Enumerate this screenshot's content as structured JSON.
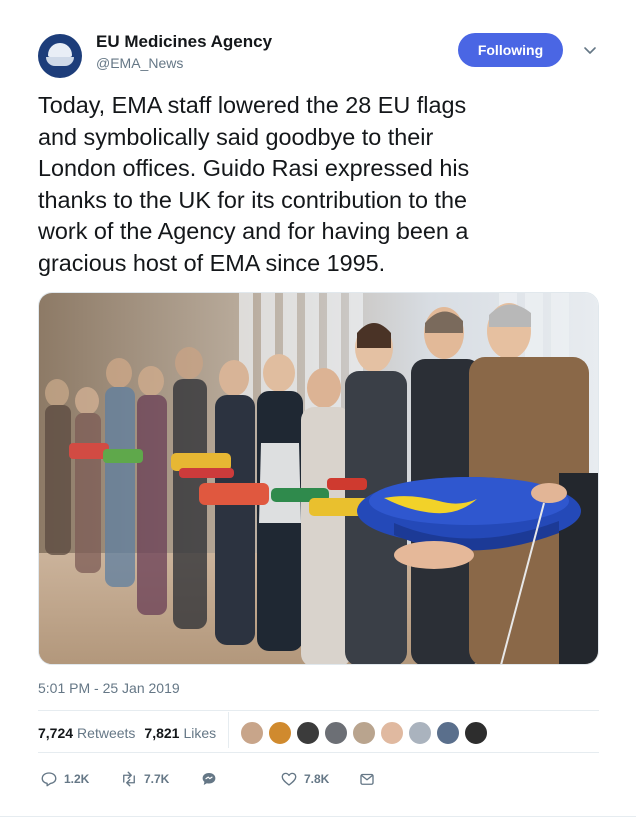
{
  "author": {
    "name": "EU Medicines Agency",
    "handle": "@EMA_News"
  },
  "follow_button": {
    "label": "Following"
  },
  "tweet": {
    "text_lines": [
      "Today, EMA staff lowered the 28 EU flags",
      "and symbolically said goodbye to their",
      "London offices. Guido Rasi expressed his",
      "thanks to the UK for its contribution to the",
      "work of the Agency and for having been a",
      "gracious host of EMA since 1995."
    ],
    "timestamp": "5:01 PM - 25 Jan 2019",
    "photo": "Staff standing in a line holding folded EU flags"
  },
  "stats": {
    "retweets_count": "7,724",
    "retweets_label": "Retweets",
    "likes_count": "7,821",
    "likes_label": "Likes"
  },
  "liker_avatar_colors": [
    "#c8a58a",
    "#d08a2e",
    "#3b3b3b",
    "#6c6f75",
    "#b9a48e",
    "#e0b9a0",
    "#aab3be",
    "#5a6f8c",
    "#2d2d2d"
  ],
  "actions": {
    "reply_count": "1.2K",
    "retweet_count": "7.7K",
    "like_count": "7.8K"
  },
  "icons": {
    "caret": "chevron-down-icon",
    "reply": "reply-icon",
    "retweet": "retweet-icon",
    "dm": "direct-message-icon",
    "like": "heart-icon",
    "share": "share-icon"
  },
  "colors": {
    "accent": "#4a66e4",
    "secondary_text": "#657786",
    "divider": "#e6ecf0"
  }
}
